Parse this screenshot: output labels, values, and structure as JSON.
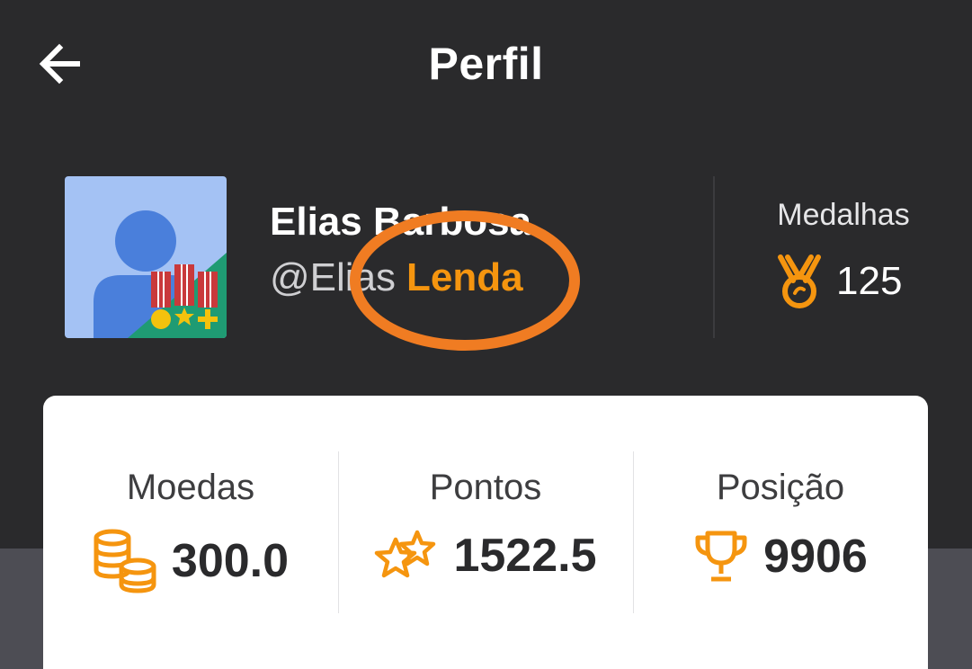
{
  "header": {
    "title": "Perfil",
    "back_icon": "arrow-left-icon"
  },
  "profile": {
    "name": "Elias Barbosa",
    "handle": "@Elias",
    "rank": "Lenda",
    "avatar_icon": "user-avatar-with-medals",
    "medals_label": "Medalhas",
    "medals_count": "125",
    "medal_icon": "medal-icon"
  },
  "stats": [
    {
      "label": "Moedas",
      "value": "300.0",
      "icon": "coins-icon"
    },
    {
      "label": "Pontos",
      "value": "1522.5",
      "icon": "stars-icon"
    },
    {
      "label": "Posição",
      "value": "9906",
      "icon": "trophy-icon"
    }
  ],
  "colors": {
    "background": "#2a2a2c",
    "accent": "#f5950f",
    "annotation": "#f07c22",
    "card": "#ffffff"
  }
}
